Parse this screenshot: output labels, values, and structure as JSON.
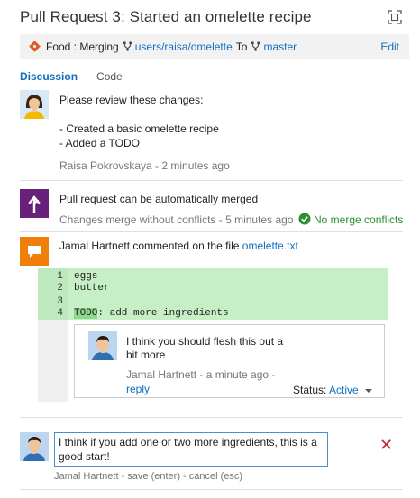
{
  "header": {
    "title": "Pull Request 3: Started an omelette recipe"
  },
  "branch_bar": {
    "prefix": "Food : Merging",
    "source_branch": "users/raisa/omelette",
    "to_label": "To",
    "target_branch": "master",
    "edit_label": "Edit"
  },
  "tabs": [
    {
      "label": "Discussion",
      "active": true
    },
    {
      "label": "Code",
      "active": false
    }
  ],
  "comment1": {
    "lines": [
      "Please review these changes:",
      "",
      "- Created a basic omelette recipe",
      "- Added a TODO"
    ],
    "meta": "Raisa Pokrovskaya - 2 minutes ago"
  },
  "merge_status": {
    "title": "Pull request can be automatically merged",
    "meta": "Changes merge without conflicts - 5 minutes ago",
    "badge": "No merge conflicts"
  },
  "file_comment": {
    "prefix": "Jamal Hartnett commented on the file",
    "file": "omelette.txt",
    "code_lines": [
      {
        "num": "1",
        "text": "eggs"
      },
      {
        "num": "2",
        "text": "butter"
      },
      {
        "num": "3",
        "text": ""
      },
      {
        "num": "4",
        "text_hl": "TODO",
        "text_rest": ": add more ingredients"
      }
    ],
    "thread": {
      "text_line1": "I think you should flesh this out a",
      "text_line2": "bit more",
      "meta": "Jamal Hartnett - a minute ago -",
      "reply": "reply",
      "status_label": "Status:",
      "status_value": "Active"
    }
  },
  "reply": {
    "value_line1": "I think if you add one or two more ingredients, this is a",
    "value_line2": "good start!",
    "meta": "Jamal Hartnett - save (enter) - cancel (esc)"
  },
  "colors": {
    "accent": "#106ebe",
    "merge_tile": "#68217a",
    "comment_tile": "#f07f09",
    "success": "#2d8f2d",
    "code_added": "#c6efc6",
    "close": "#c8262e"
  }
}
